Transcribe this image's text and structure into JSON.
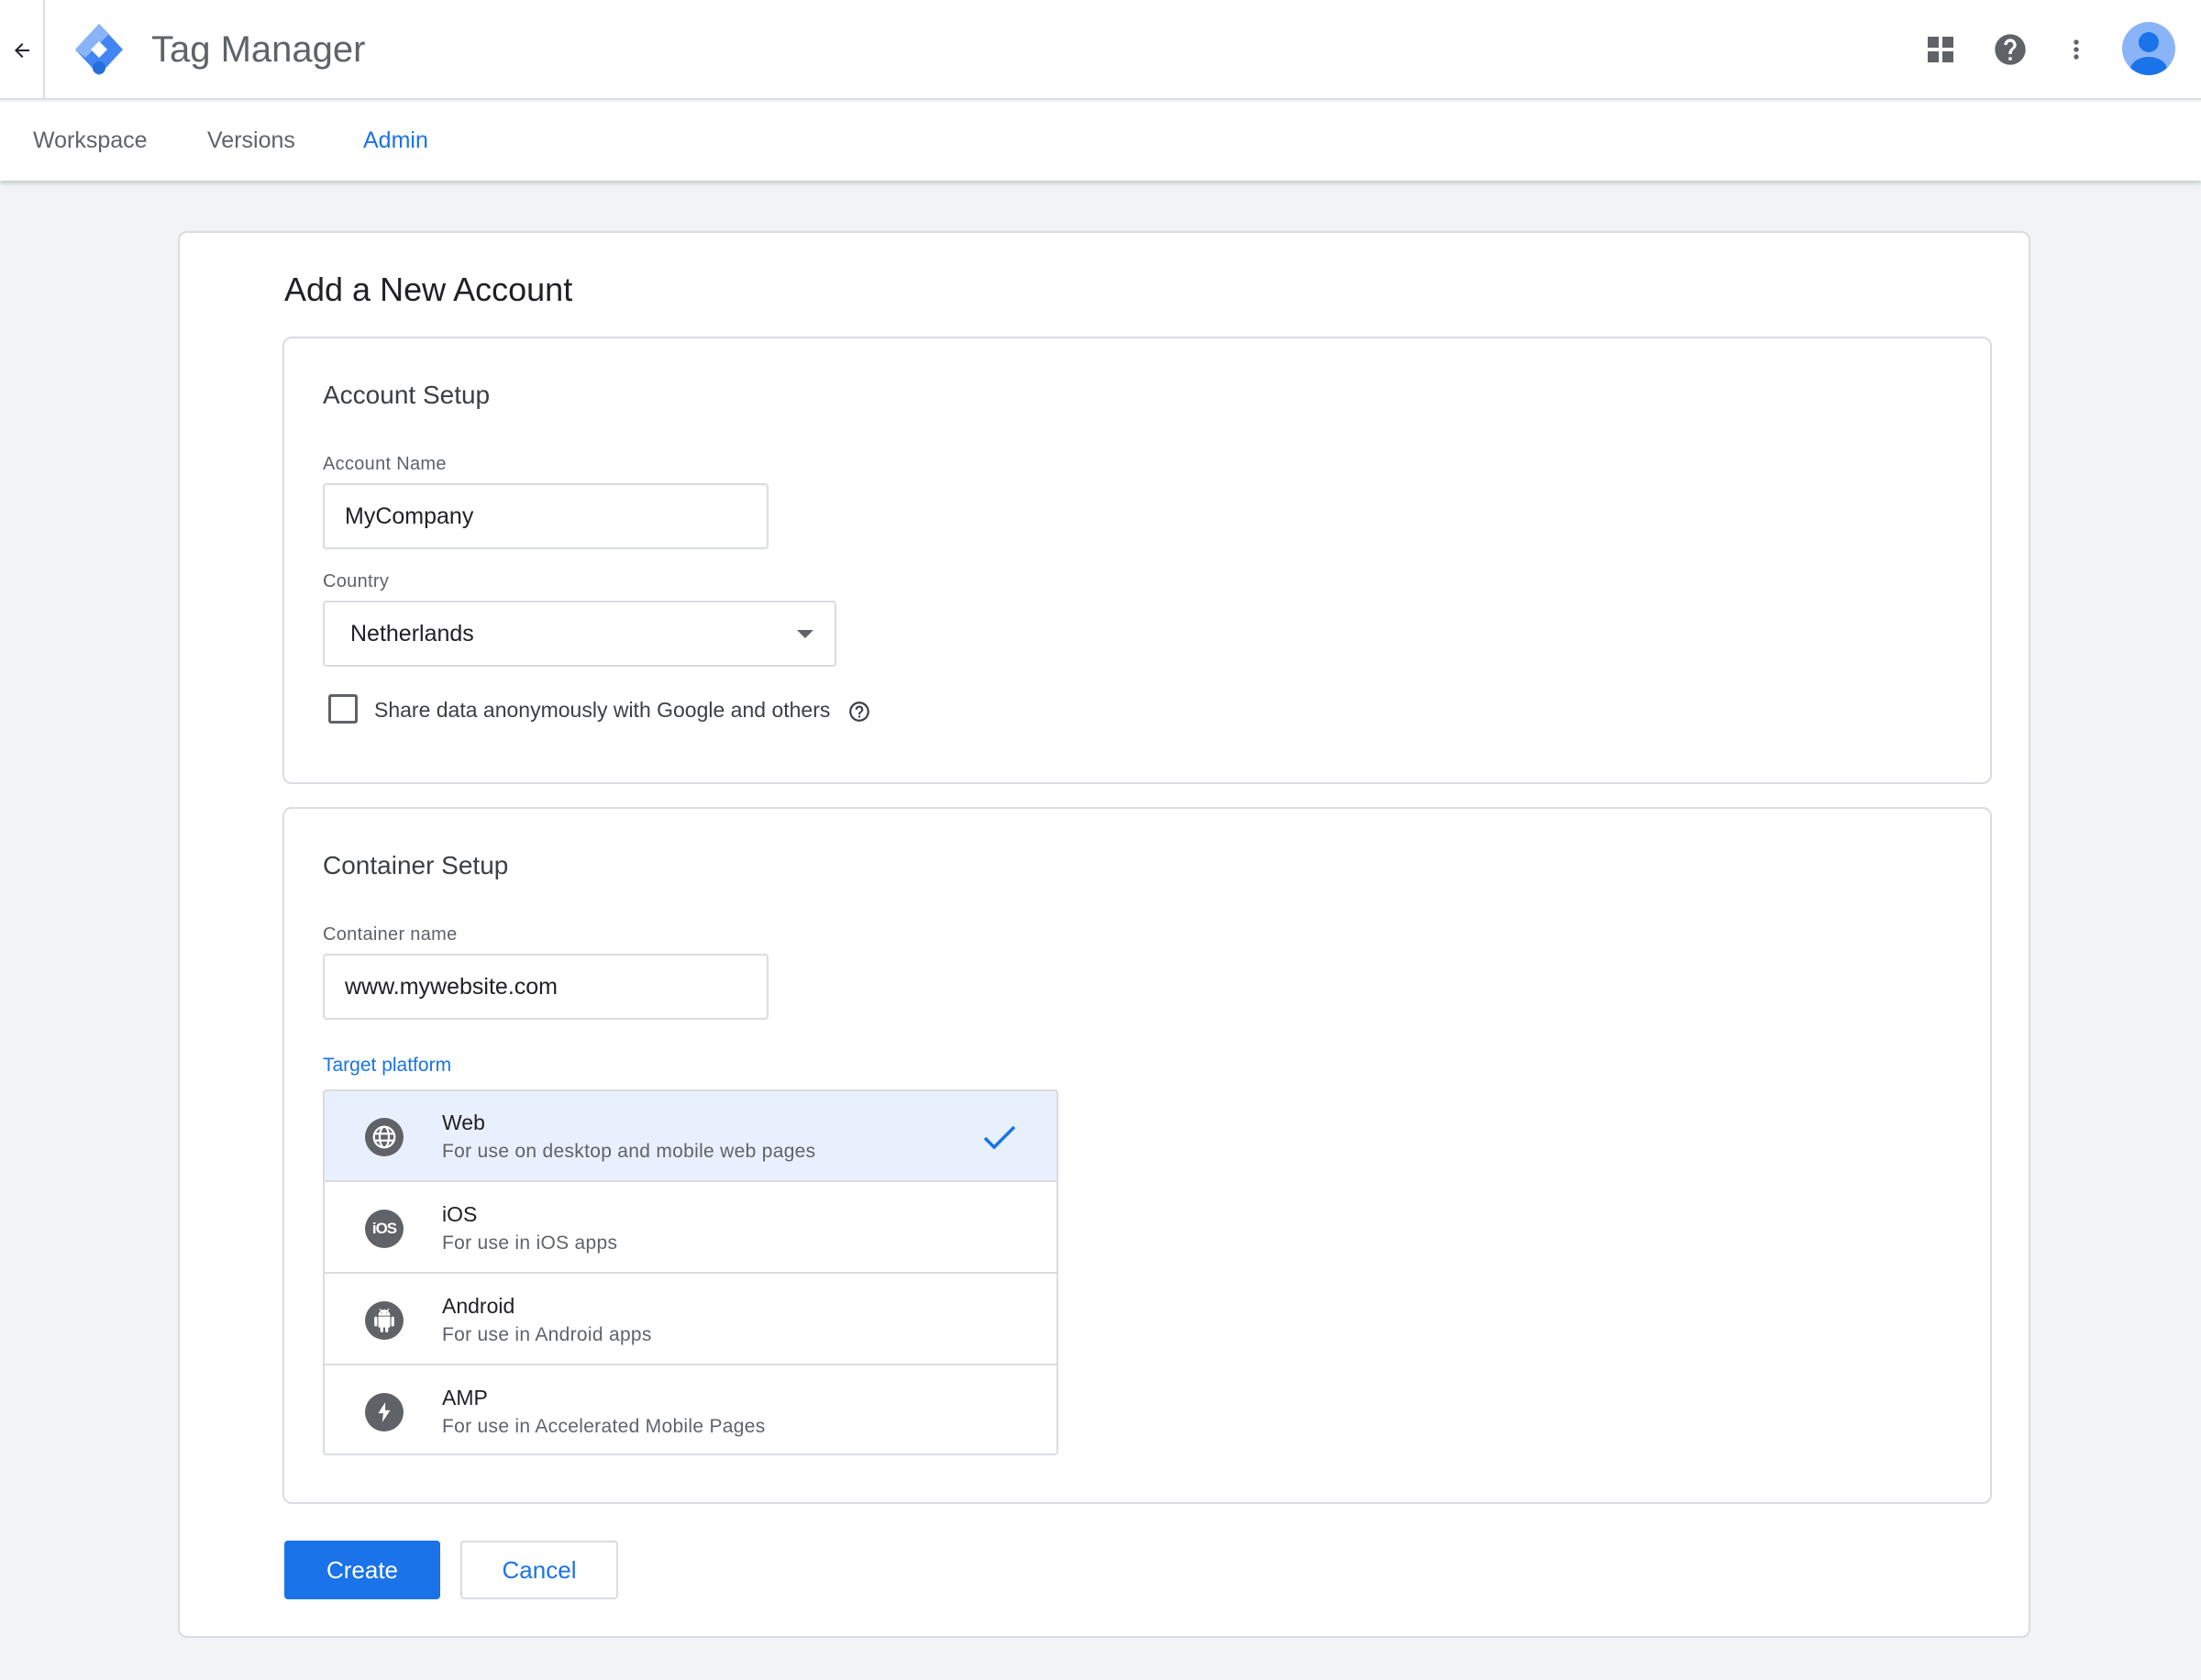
{
  "header": {
    "app_title": "Tag Manager",
    "icons": [
      "back-arrow-icon",
      "gtm-logo-icon",
      "apps-grid-icon",
      "help-icon",
      "more-vert-icon",
      "account-avatar-icon"
    ]
  },
  "nav": {
    "tabs": [
      {
        "label": "Workspace",
        "active": false
      },
      {
        "label": "Versions",
        "active": false
      },
      {
        "label": "Admin",
        "active": true
      }
    ]
  },
  "page": {
    "title": "Add a New Account"
  },
  "account_setup": {
    "title": "Account Setup",
    "account_name_label": "Account Name",
    "account_name_value": "MyCompany",
    "country_label": "Country",
    "country_value": "Netherlands",
    "share_data_label": "Share data anonymously with Google and others",
    "share_data_checked": false
  },
  "container_setup": {
    "title": "Container Setup",
    "container_name_label": "Container name",
    "container_name_value": "www.mywebsite.com",
    "target_platform_label": "Target platform",
    "platforms": [
      {
        "name": "Web",
        "description": "For use on desktop and mobile web pages",
        "icon": "globe-icon",
        "selected": true
      },
      {
        "name": "iOS",
        "description": "For use in iOS apps",
        "icon": "ios-icon",
        "selected": false
      },
      {
        "name": "Android",
        "description": "For use in Android apps",
        "icon": "android-icon",
        "selected": false
      },
      {
        "name": "AMP",
        "description": "For use in Accelerated Mobile Pages",
        "icon": "amp-bolt-icon",
        "selected": false
      }
    ]
  },
  "actions": {
    "create_label": "Create",
    "cancel_label": "Cancel"
  },
  "colors": {
    "accent": "#1a73e8",
    "selected_bg": "#e8f0fe",
    "border": "#dadce0",
    "page_bg": "#f1f3f4"
  }
}
